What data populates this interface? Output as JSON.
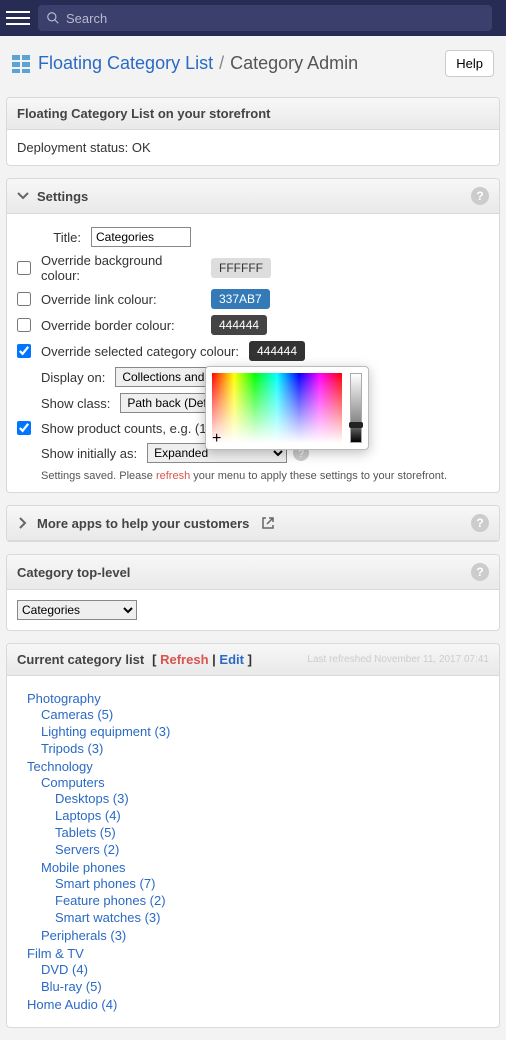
{
  "topbar": {
    "search_placeholder": "Search"
  },
  "header": {
    "crumb_root": "Floating Category List",
    "crumb_sep": "/",
    "crumb_current": "Category Admin",
    "help_label": "Help"
  },
  "status_panel": {
    "title": "Floating Category List on your storefront",
    "deployment_status_label": "Deployment status:",
    "deployment_status_value": "OK"
  },
  "settings": {
    "title": "Settings",
    "title_label": "Title:",
    "title_value": "Categories",
    "rows": {
      "override_bg": "Override background colour:",
      "override_link": "Override link colour:",
      "override_border": "Override border colour:",
      "override_selected": "Override selected category colour:",
      "display_on": "Display on:",
      "show_class": "Show class:",
      "show_counts": "Show product counts, e.g. (13)",
      "show_initially": "Show initially as:"
    },
    "values": {
      "bg_hex": "FFFFFF",
      "link_hex": "337AB7",
      "border_hex": "444444",
      "selected_hex": "444444",
      "display_on_value": "Collections and linked pages",
      "show_class_value": "Path back (Default)",
      "show_initially_value": "Expanded"
    },
    "saved_msg_pre": "Settings saved. Please ",
    "saved_msg_link": "refresh",
    "saved_msg_post": " your menu to apply these settings to your storefront."
  },
  "more_apps": {
    "title": "More apps to help your customers"
  },
  "top_level": {
    "title": "Category top-level",
    "selected": "Categories"
  },
  "category_list": {
    "title": "Current category list",
    "bracket_open": " [ ",
    "refresh": "Refresh",
    "sep": " | ",
    "edit": "Edit",
    "bracket_close": " ]",
    "last_refreshed": "Last refreshed November 11, 2017 07:41",
    "tree": [
      {
        "label": "Photography",
        "children": [
          {
            "label": "Cameras (5)"
          },
          {
            "label": "Lighting equipment (3)"
          },
          {
            "label": "Tripods (3)"
          }
        ]
      },
      {
        "label": "Technology",
        "children": [
          {
            "label": "Computers",
            "children": [
              {
                "label": "Desktops (3)"
              },
              {
                "label": "Laptops (4)"
              },
              {
                "label": "Tablets (5)"
              },
              {
                "label": "Servers (2)"
              }
            ]
          },
          {
            "label": "Mobile phones",
            "children": [
              {
                "label": "Smart phones (7)"
              },
              {
                "label": "Feature phones (2)"
              },
              {
                "label": "Smart watches (3)"
              }
            ]
          },
          {
            "label": "Peripherals (3)"
          }
        ]
      },
      {
        "label": "Film & TV",
        "children": [
          {
            "label": "DVD (4)"
          },
          {
            "label": "Blu-ray (5)"
          }
        ]
      },
      {
        "label": "Home Audio (4)"
      }
    ]
  },
  "colors": {
    "accent_blue": "#2a6ac4",
    "red": "#d9534f"
  }
}
